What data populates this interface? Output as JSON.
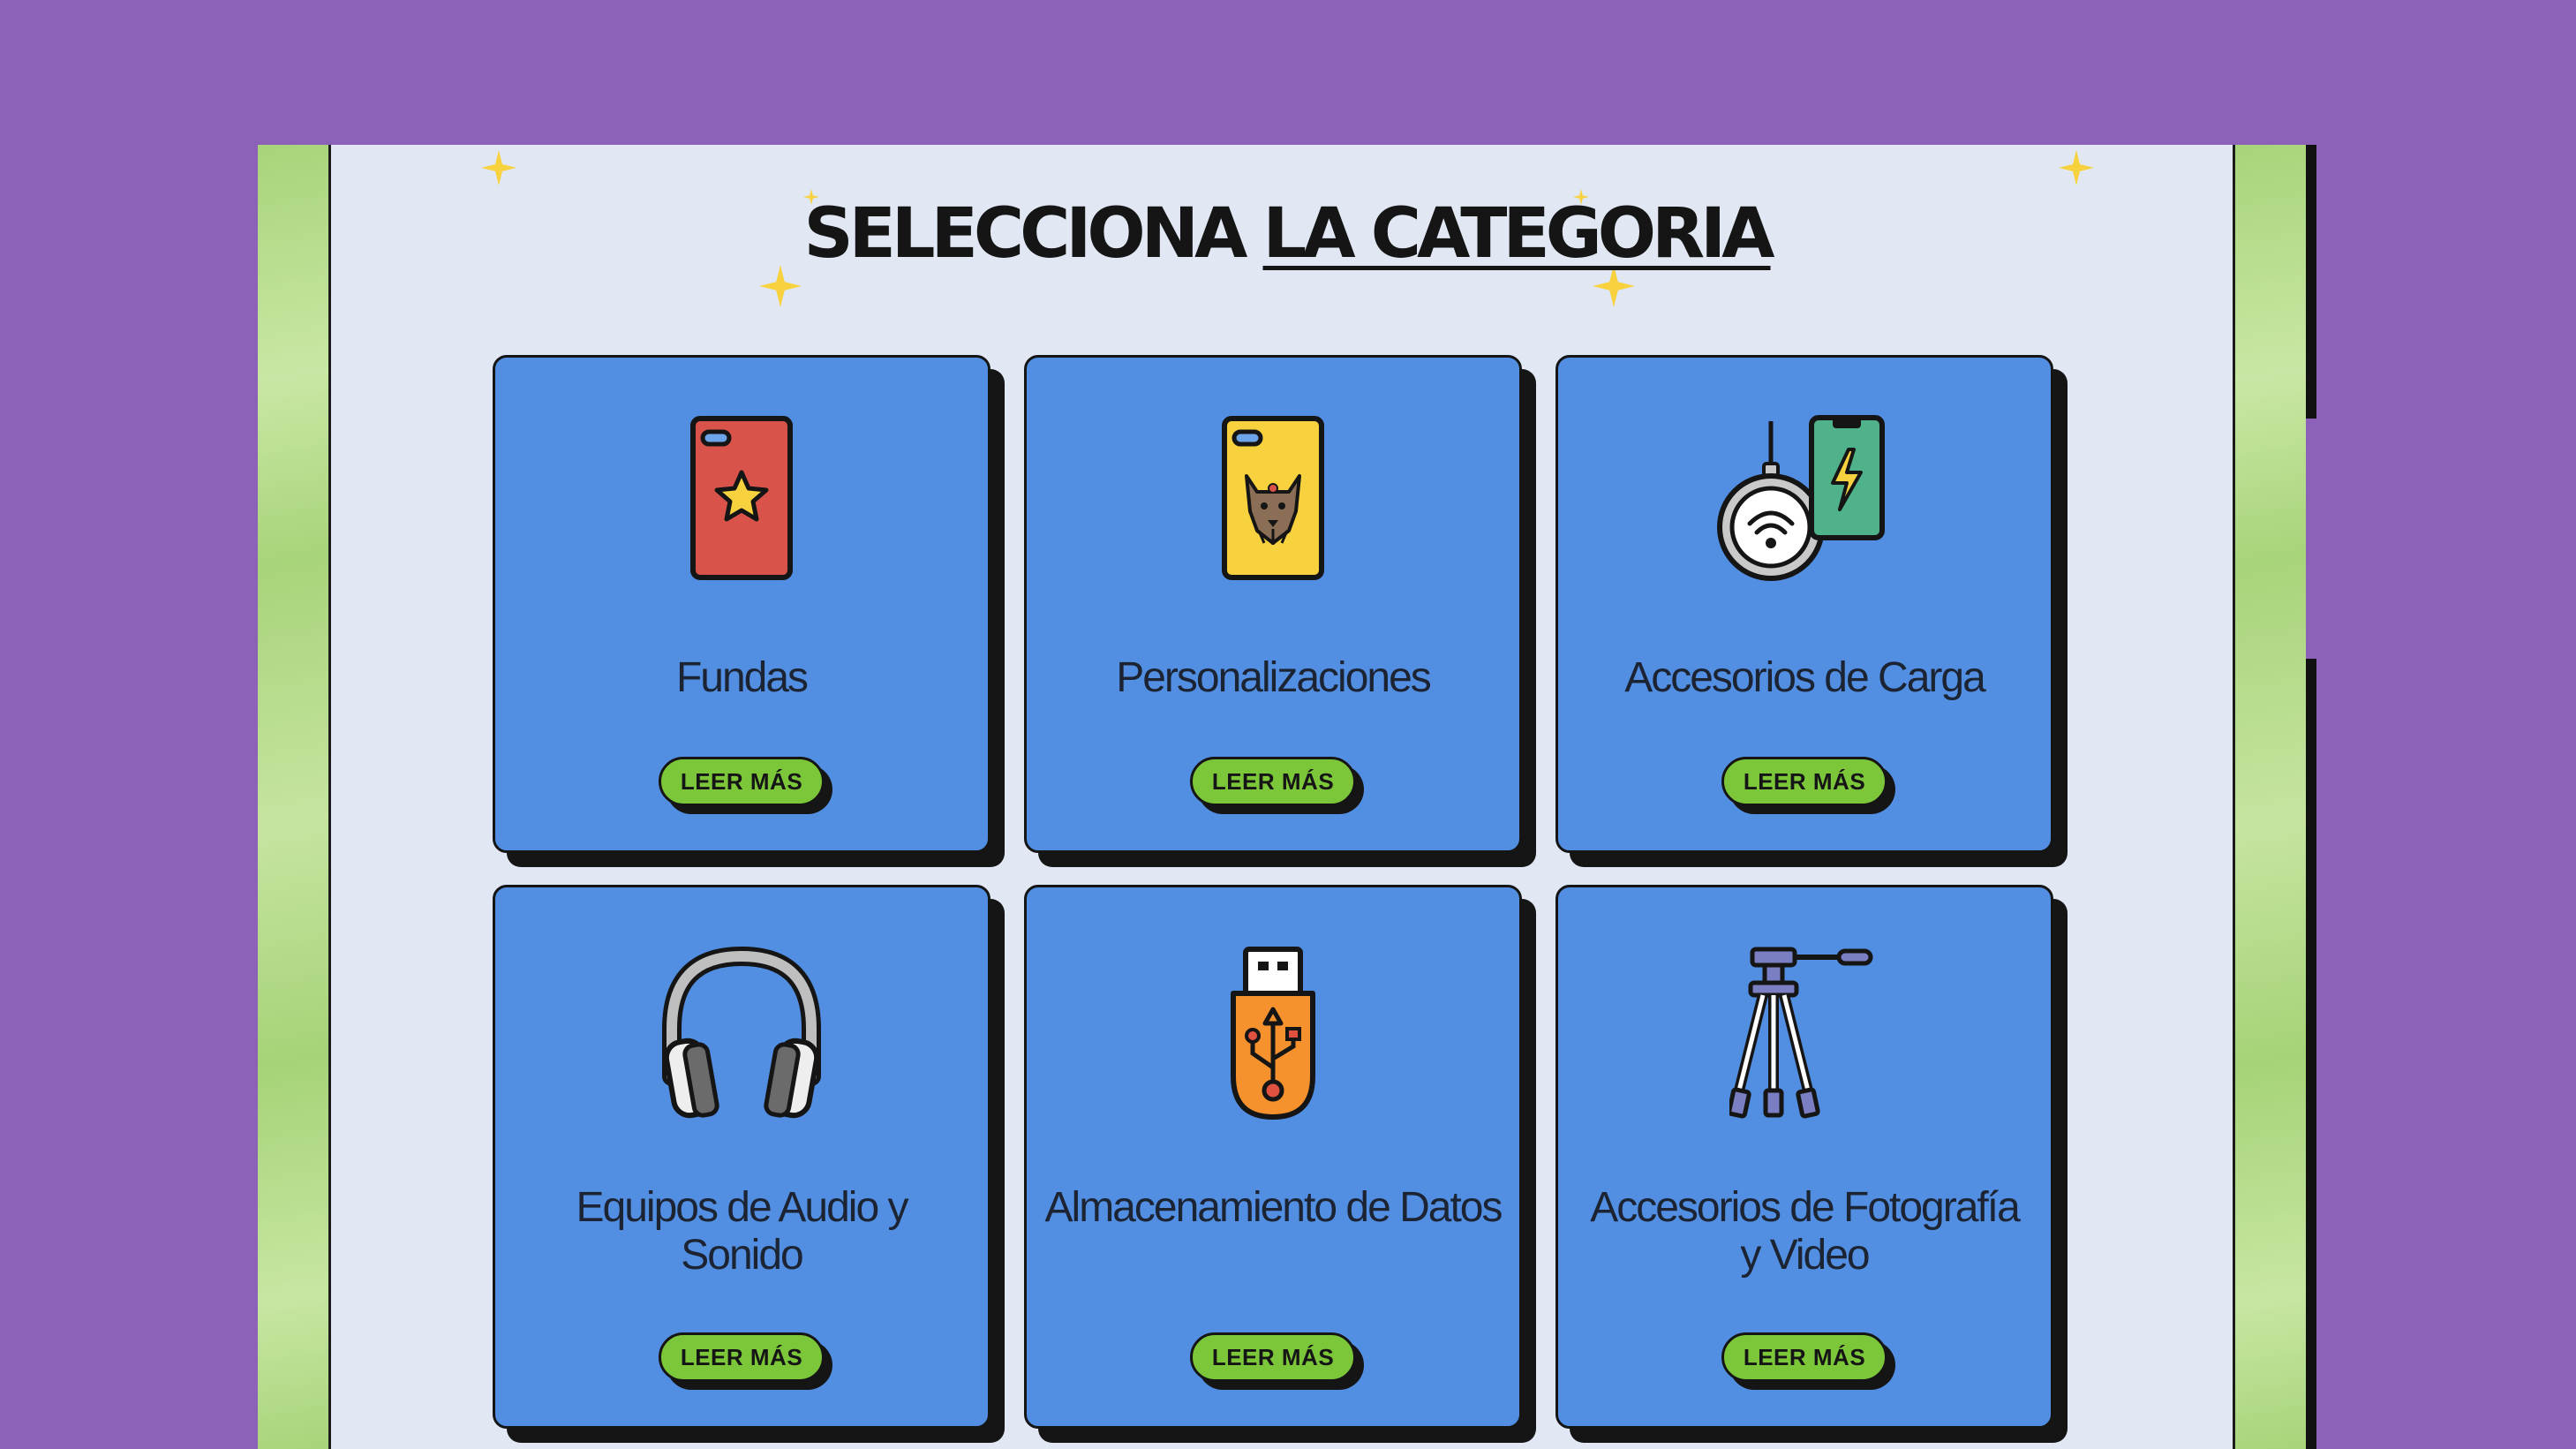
{
  "page": {
    "title_part1": "SELECCIONA",
    "title_part2": "LA CATEGORIA"
  },
  "categories": [
    {
      "label": "Fundas",
      "button": "LEER MÁS",
      "icon": "phone-case-star-icon"
    },
    {
      "label": "Personalizaciones",
      "button": "LEER MÁS",
      "icon": "phone-case-dog-icon"
    },
    {
      "label": "Accesorios de Carga",
      "button": "LEER MÁS",
      "icon": "wireless-charger-icon"
    },
    {
      "label": "Equipos de Audio y Sonido",
      "button": "LEER MÁS",
      "icon": "headphones-icon"
    },
    {
      "label": "Almacenamiento de Datos",
      "button": "LEER MÁS",
      "icon": "usb-drive-icon"
    },
    {
      "label": "Accesorios de Fotografía y Video",
      "button": "LEER MÁS",
      "icon": "tripod-icon"
    }
  ],
  "colors": {
    "background": "#8c62b8",
    "panel": "#e1e8f4",
    "card": "#528fe2",
    "button": "#7cc63a",
    "sparkle": "#f7d23e",
    "side_stripe": "#a8d47a"
  }
}
